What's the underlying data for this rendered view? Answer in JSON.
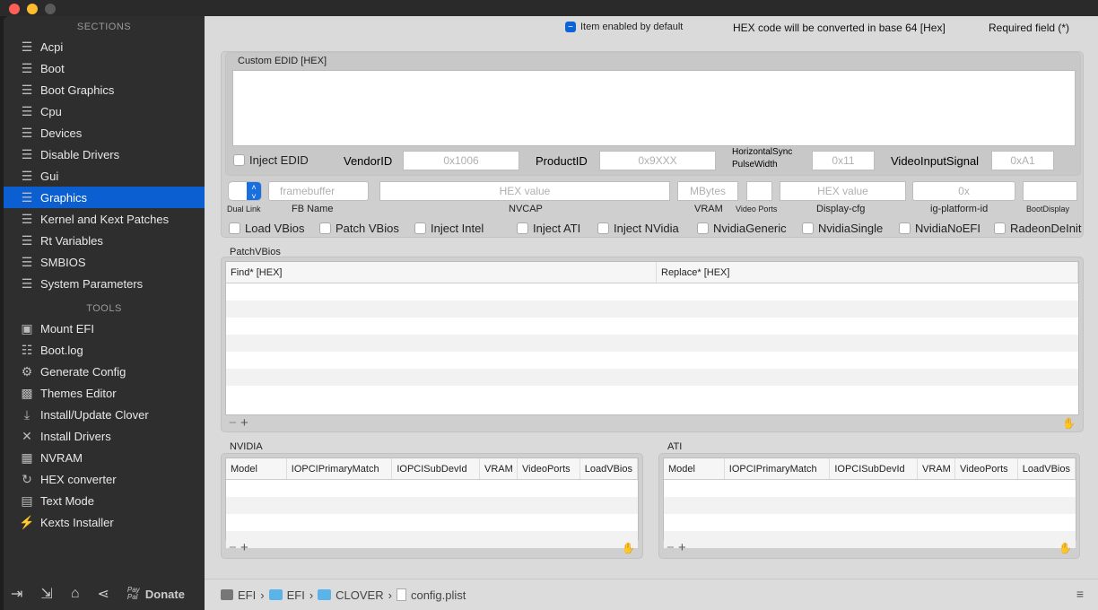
{
  "sidebar": {
    "sections_header": "SECTIONS",
    "sections": [
      "Acpi",
      "Boot",
      "Boot Graphics",
      "Cpu",
      "Devices",
      "Disable Drivers",
      "Gui",
      "Graphics",
      "Kernel and Kext Patches",
      "Rt Variables",
      "SMBIOS",
      "System Parameters"
    ],
    "active": "Graphics",
    "tools_header": "TOOLS",
    "tools": [
      {
        "label": "Mount EFI",
        "icon": "disk-icon"
      },
      {
        "label": "Boot.log",
        "icon": "log-icon"
      },
      {
        "label": "Generate Config",
        "icon": "gears-icon"
      },
      {
        "label": "Themes Editor",
        "icon": "image-icon"
      },
      {
        "label": "Install/Update Clover",
        "icon": "download-icon"
      },
      {
        "label": "Install Drivers",
        "icon": "wrench-icon"
      },
      {
        "label": "NVRAM",
        "icon": "chip-icon"
      },
      {
        "label": "HEX converter",
        "icon": "refresh-icon"
      },
      {
        "label": "Text Mode",
        "icon": "text-icon"
      },
      {
        "label": "Kexts Installer",
        "icon": "plug-icon"
      }
    ],
    "footer": {
      "paypal": "Pay Pal",
      "donate": "Donate"
    }
  },
  "header": {
    "item_enabled": "Item enabled by default",
    "hex_note": "HEX code will be converted in base 64 [Hex]",
    "required": "Required field (*)"
  },
  "edid": {
    "label": "Custom EDID [HEX]",
    "inject": "Inject EDID",
    "vendor_label": "VendorID",
    "vendor_ph": "0x1006",
    "product_label": "ProductID",
    "product_ph": "0x9XXX",
    "hsync_label1": "HorizontalSync",
    "hsync_label2": "PulseWidth",
    "hsync_ph": "0x11",
    "vis_label": "VideoInputSignal",
    "vis_ph": "0xA1"
  },
  "gfx": {
    "dual_link": "Dual Link",
    "fb_ph": "framebuffer",
    "fb_label": "FB Name",
    "nvcap_ph": "HEX value",
    "nvcap_label": "NVCAP",
    "vram_ph": "MBytes",
    "vram_label": "VRAM",
    "ports_label": "Video Ports",
    "dcfg_ph": "HEX value",
    "dcfg_label": "Display-cfg",
    "ig_ph": "0x",
    "ig_label": "ig-platform-id",
    "boot_label": "BootDisplay"
  },
  "checks": [
    "Load VBios",
    "Patch VBios",
    "Inject Intel",
    "Inject ATI",
    "Inject NVidia",
    "NvidiaGeneric",
    "NvidiaSingle",
    "NvidiaNoEFI",
    "RadeonDeInit"
  ],
  "patch": {
    "label": "PatchVBios",
    "cols": [
      "Find* [HEX]",
      "Replace* [HEX]"
    ]
  },
  "nvidia": {
    "label": "NVIDIA",
    "cols": [
      "Model",
      "IOPCIPrimaryMatch",
      "IOPCISubDevId",
      "VRAM",
      "VideoPorts",
      "LoadVBios"
    ]
  },
  "ati": {
    "label": "ATI",
    "cols": [
      "Model",
      "IOPCIPrimaryMatch",
      "IOPCISubDevId",
      "VRAM",
      "VideoPorts",
      "LoadVBios"
    ]
  },
  "breadcrumb": [
    "EFI",
    "EFI",
    "CLOVER",
    "config.plist"
  ]
}
